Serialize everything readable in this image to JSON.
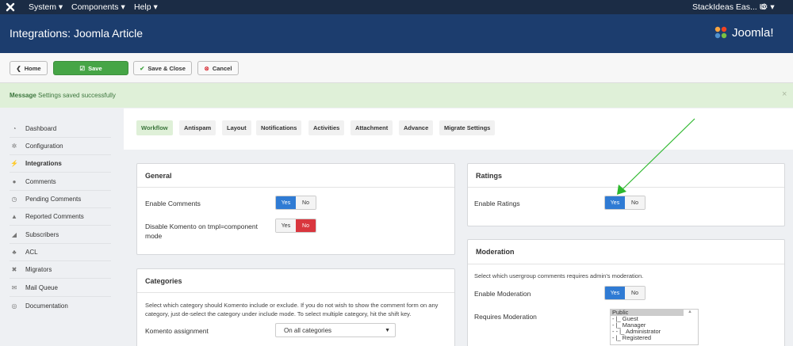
{
  "topbar": {
    "menus": [
      "System",
      "Components",
      "Help"
    ],
    "site": "StackIdeas Eas...",
    "settings_caret": "▾"
  },
  "header": {
    "title": "Integrations: Joomla Article",
    "brand": "Joomla!"
  },
  "toolbar": {
    "home": "Home",
    "save": "Save",
    "save_close": "Save & Close",
    "cancel": "Cancel"
  },
  "message": {
    "heading": "Message",
    "text": "Settings saved successfully",
    "close": "×"
  },
  "sidebar": {
    "items": [
      {
        "label": "Dashboard",
        "icon": "dashboard-icon"
      },
      {
        "label": "Configuration",
        "icon": "gear-icon"
      },
      {
        "label": "Integrations",
        "icon": "plug-icon"
      },
      {
        "label": "Comments",
        "icon": "comment-icon"
      },
      {
        "label": "Pending Comments",
        "icon": "clock-icon"
      },
      {
        "label": "Reported Comments",
        "icon": "warning-icon"
      },
      {
        "label": "Subscribers",
        "icon": "rss-icon"
      },
      {
        "label": "ACL",
        "icon": "users-icon"
      },
      {
        "label": "Migrators",
        "icon": "cross-icon"
      },
      {
        "label": "Mail Queue",
        "icon": "mail-icon"
      },
      {
        "label": "Documentation",
        "icon": "lifebuoy-icon"
      }
    ]
  },
  "tabs": [
    "Workflow",
    "Antispam",
    "Layout",
    "Notifications",
    "Activities",
    "Attachment",
    "Advance",
    "Migrate Settings"
  ],
  "general": {
    "title": "General",
    "enable_comments": "Enable Comments",
    "disable_komento": "Disable Komento on tmpl=component mode",
    "yes": "Yes",
    "no": "No"
  },
  "categories": {
    "title": "Categories",
    "description": "Select which category should Komento include or exclude. If you do not wish to show the comment form on any category, just de-select the category under include mode. To select multiple category, hit the shift key.",
    "assignment_label": "Komento assignment",
    "assignment_value": "On all categories"
  },
  "ratings": {
    "title": "Ratings",
    "enable_ratings": "Enable Ratings"
  },
  "moderation": {
    "title": "Moderation",
    "description": "Select which usergroup comments requires admin's moderation.",
    "enable_moderation": "Enable Moderation",
    "requires_moderation": "Requires Moderation",
    "groups": [
      "Public",
      "- |_ Guest",
      "- |_ Manager",
      "- - |_ Administrator",
      "- |_ Registered"
    ]
  },
  "colors": {
    "accent": "#2f7bd4",
    "green": "#46a546",
    "header": "#1c3d6e",
    "arrow": "#2db82d"
  }
}
